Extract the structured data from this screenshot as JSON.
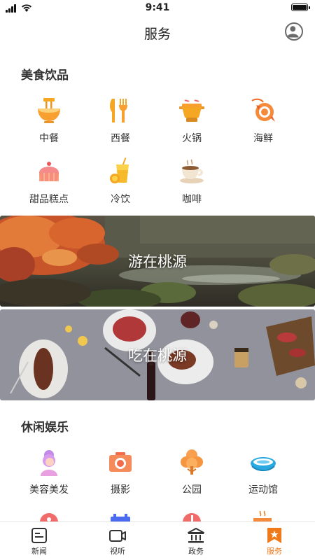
{
  "status_bar": {
    "time": "9:41"
  },
  "nav": {
    "title": "服务"
  },
  "food": {
    "title": "美食饮品",
    "items": [
      {
        "label": "中餐",
        "icon": "noodle-bowl-icon"
      },
      {
        "label": "西餐",
        "icon": "fork-knife-icon"
      },
      {
        "label": "火锅",
        "icon": "hotpot-icon"
      },
      {
        "label": "海鲜",
        "icon": "shrimp-icon"
      },
      {
        "label": "甜品糕点",
        "icon": "cake-icon"
      },
      {
        "label": "冷饮",
        "icon": "cold-drink-icon"
      },
      {
        "label": "咖啡",
        "icon": "coffee-cup-icon"
      }
    ]
  },
  "banners": [
    {
      "text": "游在桃源",
      "theme": "autumn-stream-photo"
    },
    {
      "text": "吃在桃源",
      "theme": "steak-dinner-photo"
    }
  ],
  "leisure": {
    "title": "休闲娱乐",
    "items": [
      {
        "label": "美容美发",
        "icon": "beauty-woman-icon"
      },
      {
        "label": "摄影",
        "icon": "camera-icon"
      },
      {
        "label": "公园",
        "icon": "tree-icon"
      },
      {
        "label": "运动馆",
        "icon": "stadium-icon"
      }
    ]
  },
  "tabs": [
    {
      "label": "新闻",
      "icon": "news-icon"
    },
    {
      "label": "视听",
      "icon": "video-icon"
    },
    {
      "label": "政务",
      "icon": "government-building-icon"
    },
    {
      "label": "服务",
      "icon": "service-bookmark-icon",
      "active": true
    }
  ],
  "colors": {
    "accent": "#f07a1a",
    "icon_orange": "#f5a623",
    "text": "#333333"
  }
}
